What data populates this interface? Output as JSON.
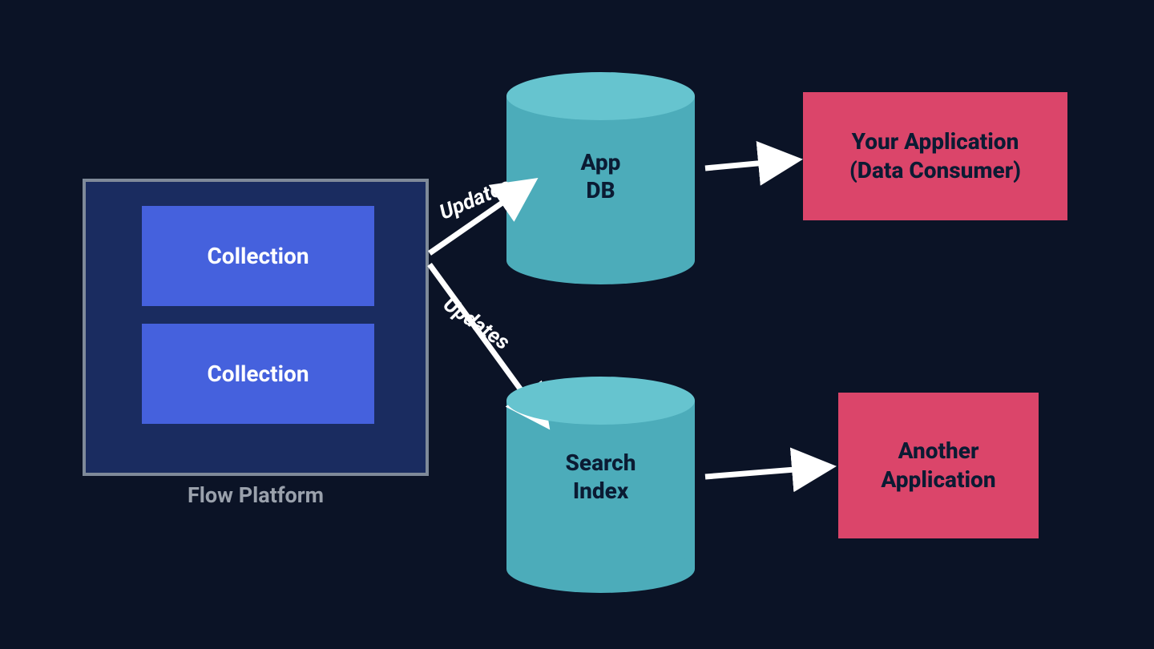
{
  "platform": {
    "label": "Flow Platform",
    "collections": [
      "Collection",
      "Collection"
    ]
  },
  "cylinders": {
    "app_db": {
      "line1": "App",
      "line2": "DB"
    },
    "search_index": {
      "line1": "Search",
      "line2": "Index"
    }
  },
  "apps": {
    "your_app": {
      "line1": "Your Application",
      "line2": "(Data Consumer)"
    },
    "another_app": {
      "line1": "Another",
      "line2": "Application"
    }
  },
  "edges": {
    "updates1": "Updates",
    "updates2": "Updates"
  },
  "colors": {
    "bg": "#0b1326",
    "platform_border": "#7f8a99",
    "platform_fill": "#1a2c60",
    "collection": "#4561dd",
    "cyl_top": "#66c4cf",
    "cyl_body": "#4cacba",
    "app_box": "#db456a",
    "text_dark": "#0b1b33",
    "arrow": "#ffffff"
  }
}
